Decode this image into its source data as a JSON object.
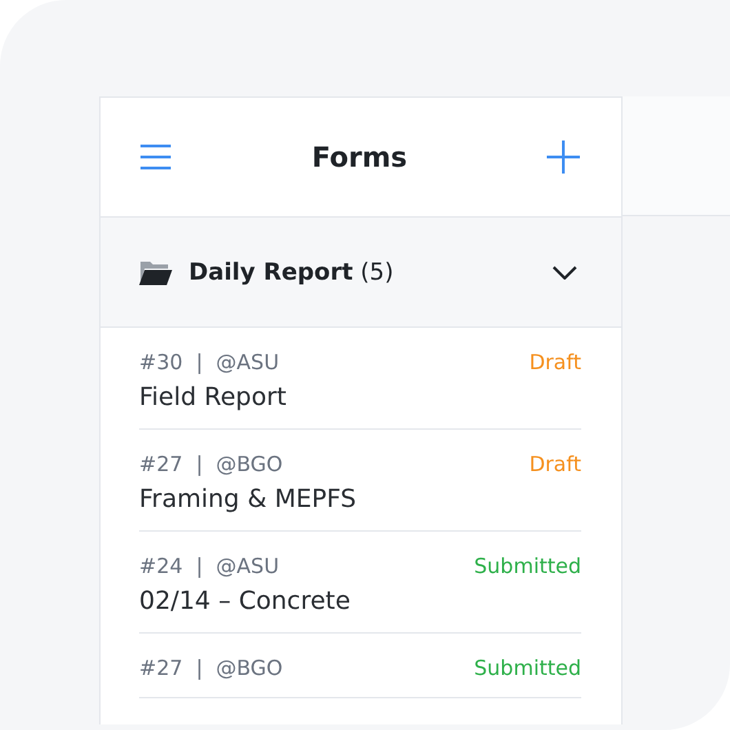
{
  "header": {
    "title": "Forms"
  },
  "folder": {
    "name": "Daily Report",
    "count": "(5)",
    "expanded": true
  },
  "forms": [
    {
      "meta": "#30  |  @ASU",
      "status": "Draft",
      "kind": "draft",
      "title": "Field Report"
    },
    {
      "meta": "#27  |  @BGO",
      "status": "Draft",
      "kind": "draft",
      "title": "Framing & MEPFS"
    },
    {
      "meta": "#24  |  @ASU",
      "status": "Submitted",
      "kind": "submitted",
      "title": "02/14 – Concrete"
    },
    {
      "meta": "#27  |  @BGO",
      "status": "Submitted",
      "kind": "submitted"
    }
  ]
}
